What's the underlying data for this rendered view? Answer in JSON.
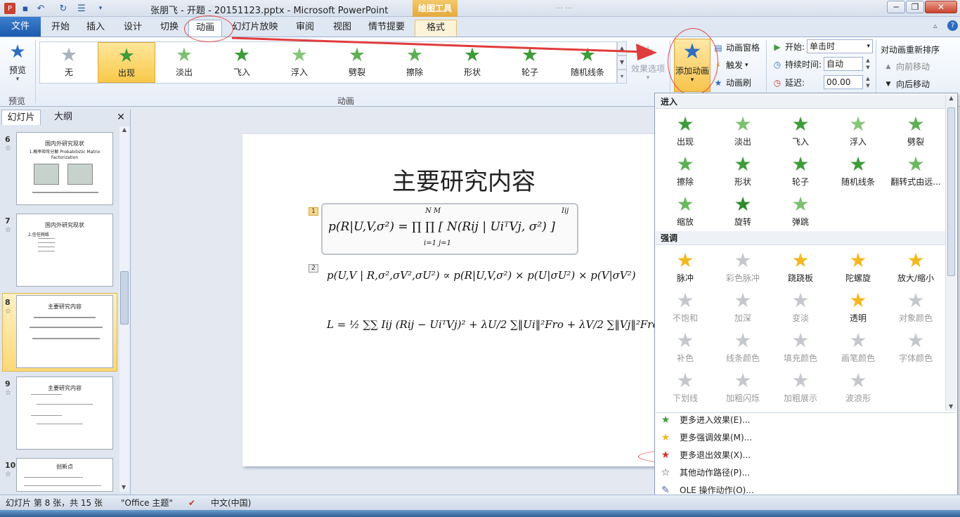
{
  "window": {
    "title": "张朋飞 - 开题 - 20151123.pptx - Microsoft PowerPoint",
    "context_tab_group": "绘图工具",
    "background_window_text": "... ...",
    "controls": {
      "minimize": "─",
      "restore": "❐",
      "close": "✕"
    },
    "help": "?"
  },
  "tabs": {
    "file": "文件",
    "items": [
      "开始",
      "插入",
      "设计",
      "切换",
      "动画",
      "幻灯片放映",
      "审阅",
      "视图",
      "情节提要",
      "格式"
    ],
    "active": "动画"
  },
  "ribbon": {
    "preview": {
      "label": "预览",
      "group": "预览"
    },
    "gallery": {
      "items": [
        "无",
        "出现",
        "淡出",
        "飞入",
        "浮入",
        "劈裂",
        "擦除",
        "形状",
        "轮子",
        "随机线条"
      ],
      "selected": "出现"
    },
    "effect_options": "效果选项",
    "group_animation": "动画",
    "add_animation": "添加动画",
    "anim_pane": "动画窗格",
    "trigger": "触发",
    "anim_painter": "动画刷",
    "timing": {
      "start_label": "开始:",
      "start_value": "单击时",
      "duration_label": "持续时间:",
      "duration_value": "自动",
      "delay_label": "延迟:",
      "delay_value": "00.00"
    },
    "reorder": {
      "title": "对动画重新排序",
      "forward": "向前移动",
      "backward": "向后移动"
    }
  },
  "left_panel": {
    "tabs": [
      "幻灯片",
      "大纲"
    ],
    "close": "✕",
    "slides": [
      {
        "num": "6",
        "title": "国内外研究现状",
        "body": "1.概率矩阵分解 Probabilistic Matrix Factorization"
      },
      {
        "num": "7",
        "title": "国内外研究现状",
        "body": "2.信任网络"
      },
      {
        "num": "8",
        "title": "主要研究内容",
        "body": ""
      },
      {
        "num": "9",
        "title": "主要研究内容",
        "body": ""
      },
      {
        "num": "10",
        "title": "创新点",
        "body": ""
      }
    ],
    "selected": "8"
  },
  "slide": {
    "title": "主要研究内容",
    "tags": [
      "1",
      "2"
    ],
    "eq1": "p(R|U,V,σ²) = ∏ ∏ [ N(Rij | UiᵀVj, σ²) ]",
    "eq1_top": "N   M",
    "eq1_bottom": "i=1  j=1",
    "eq1_exp": "Iij",
    "eq2": "p(U,V | R,σ²,σV²,σU²) ∝ p(R|U,V,σ²) × p(U|σU²) × p(V|σV²)",
    "eq3": "L = ½ ∑∑ Iij (Rij − UiᵀVj)² + λU/2 ∑‖Ui‖²Fro + λV/2 ∑‖Vj‖²Fro"
  },
  "dropdown": {
    "sections": {
      "enter": "进入",
      "emphasis": "强调"
    },
    "enter": [
      "出现",
      "淡出",
      "飞入",
      "浮入",
      "劈裂",
      "擦除",
      "形状",
      "轮子",
      "随机线条",
      "翻转式由远...",
      "缩放",
      "旋转",
      "弹跳"
    ],
    "emphasis": [
      "脉冲",
      "彩色脉冲",
      "跷跷板",
      "陀螺旋",
      "放大/缩小",
      "不饱和",
      "加深",
      "变淡",
      "透明",
      "对象颜色",
      "补色",
      "线条颜色",
      "填充颜色",
      "画笔颜色",
      "字体颜色",
      "下划线",
      "加粗闪烁",
      "加粗展示",
      "波浪形"
    ],
    "emphasis_enabled": [
      "脉冲",
      "跷跷板",
      "陀螺旋",
      "放大/缩小",
      "透明"
    ],
    "menu": [
      "更多进入效果(E)...",
      "更多强调效果(M)...",
      "更多退出效果(X)...",
      "其他动作路径(P)...",
      "OLE 操作动作(O)..."
    ]
  },
  "status": {
    "slide_info": "幻灯片 第 8 张，共 15 张",
    "theme": "\"Office 主题\"",
    "language": "中文(中国)"
  },
  "colors": {
    "enter_star": "#3e9b3a",
    "emphasis_star": "#f3b820",
    "exit_star": "#d8312c",
    "annotation_red": "#e04a4a",
    "selection_gold": "#f8c94a"
  }
}
